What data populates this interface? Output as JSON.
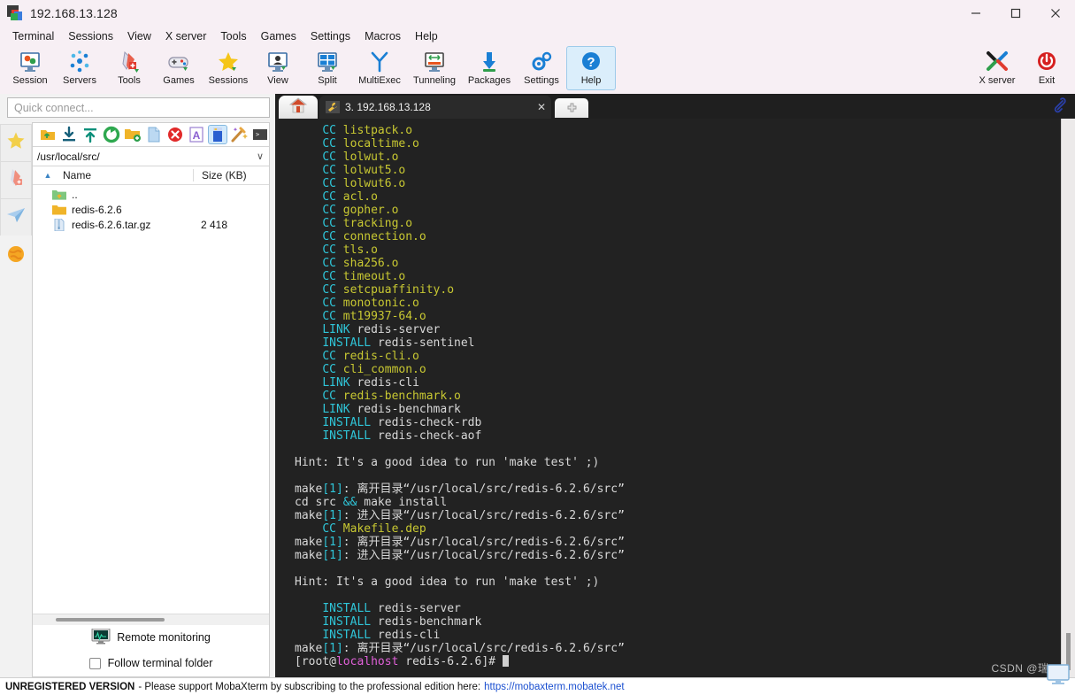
{
  "window": {
    "title": "192.168.13.128",
    "app_icon": "mobaxterm-logo-icon",
    "minimize": "—",
    "maximize": "□",
    "close": "✕"
  },
  "menubar": {
    "items": [
      {
        "label": "Terminal"
      },
      {
        "label": "Sessions"
      },
      {
        "label": "View"
      },
      {
        "label": "X server"
      },
      {
        "label": "Tools"
      },
      {
        "label": "Games"
      },
      {
        "label": "Settings"
      },
      {
        "label": "Macros"
      },
      {
        "label": "Help"
      }
    ]
  },
  "toolbar": {
    "buttons": [
      {
        "label": "Session",
        "icon": "session-icon",
        "selected": false
      },
      {
        "label": "Servers",
        "icon": "servers-icon",
        "selected": false
      },
      {
        "label": "Tools",
        "icon": "tools-icon",
        "selected": false
      },
      {
        "label": "Games",
        "icon": "games-icon",
        "selected": false
      },
      {
        "label": "Sessions",
        "icon": "sessions-star-icon",
        "selected": false
      },
      {
        "label": "View",
        "icon": "view-icon",
        "selected": false
      },
      {
        "label": "Split",
        "icon": "split-icon",
        "selected": false
      },
      {
        "label": "MultiExec",
        "icon": "multiexec-icon",
        "selected": false
      },
      {
        "label": "Tunneling",
        "icon": "tunneling-icon",
        "selected": false
      },
      {
        "label": "Packages",
        "icon": "packages-icon",
        "selected": false
      },
      {
        "label": "Settings",
        "icon": "settings-gear-icon",
        "selected": false
      },
      {
        "label": "Help",
        "icon": "help-icon",
        "selected": true
      }
    ],
    "right_buttons": [
      {
        "label": "X server",
        "icon": "x-server-icon"
      },
      {
        "label": "Exit",
        "icon": "exit-power-icon"
      }
    ]
  },
  "sidebar": {
    "quick_connect_placeholder": "Quick connect...",
    "rail_items": [
      {
        "icon": "star-bookmarks-icon"
      },
      {
        "icon": "tools-knife-icon"
      },
      {
        "icon": "paper-plane-sftp-icon"
      },
      {
        "icon": "globe-icon"
      }
    ],
    "sftp_toolbar": [
      {
        "icon": "go-up-folder-icon",
        "selected": false
      },
      {
        "icon": "download-icon",
        "selected": false
      },
      {
        "icon": "upload-icon",
        "selected": false
      },
      {
        "icon": "refresh-icon",
        "selected": false
      },
      {
        "icon": "new-folder-icon",
        "selected": false
      },
      {
        "icon": "new-file-icon",
        "selected": false
      },
      {
        "icon": "delete-icon",
        "selected": false
      },
      {
        "icon": "text-edit-icon",
        "selected": false
      },
      {
        "icon": "toggle-panel-icon",
        "selected": true
      },
      {
        "icon": "magic-wand-icon",
        "selected": false
      },
      {
        "icon": "open-terminal-icon",
        "selected": false
      }
    ],
    "path": "/usr/local/src/",
    "path_chevron": "∨",
    "columns": {
      "sort_arrow": "▲",
      "name": "Name",
      "size": "Size (KB)"
    },
    "files": [
      {
        "name": "..",
        "size": "",
        "icon": "parent-folder-icon"
      },
      {
        "name": "redis-6.2.6",
        "size": "",
        "icon": "folder-icon"
      },
      {
        "name": "redis-6.2.6.tar.gz",
        "size": "2 418",
        "icon": "archive-file-icon"
      }
    ],
    "remote_monitoring_label": "Remote monitoring",
    "follow_terminal_label": "Follow terminal folder",
    "follow_terminal_checked": false
  },
  "tabs": {
    "home_icon": "home-icon",
    "items": [
      {
        "label": "3. 192.168.13.128",
        "icon": "wrench-icon",
        "close": "✕",
        "active": true
      }
    ],
    "new_tab": "+",
    "clip_icon": "paperclip-icon"
  },
  "terminal": {
    "lines": [
      {
        "indent": 4,
        "segments": [
          {
            "t": "CC",
            "c": "cyan"
          },
          {
            "t": " listpack.o",
            "c": "yellow"
          }
        ]
      },
      {
        "indent": 4,
        "segments": [
          {
            "t": "CC",
            "c": "cyan"
          },
          {
            "t": " localtime.o",
            "c": "yellow"
          }
        ]
      },
      {
        "indent": 4,
        "segments": [
          {
            "t": "CC",
            "c": "cyan"
          },
          {
            "t": " lolwut.o",
            "c": "yellow"
          }
        ]
      },
      {
        "indent": 4,
        "segments": [
          {
            "t": "CC",
            "c": "cyan"
          },
          {
            "t": " lolwut5.o",
            "c": "yellow"
          }
        ]
      },
      {
        "indent": 4,
        "segments": [
          {
            "t": "CC",
            "c": "cyan"
          },
          {
            "t": " lolwut6.o",
            "c": "yellow"
          }
        ]
      },
      {
        "indent": 4,
        "segments": [
          {
            "t": "CC",
            "c": "cyan"
          },
          {
            "t": " acl.o",
            "c": "yellow"
          }
        ]
      },
      {
        "indent": 4,
        "segments": [
          {
            "t": "CC",
            "c": "cyan"
          },
          {
            "t": " gopher.o",
            "c": "yellow"
          }
        ]
      },
      {
        "indent": 4,
        "segments": [
          {
            "t": "CC",
            "c": "cyan"
          },
          {
            "t": " tracking.o",
            "c": "yellow"
          }
        ]
      },
      {
        "indent": 4,
        "segments": [
          {
            "t": "CC",
            "c": "cyan"
          },
          {
            "t": " connection.o",
            "c": "yellow"
          }
        ]
      },
      {
        "indent": 4,
        "segments": [
          {
            "t": "CC",
            "c": "cyan"
          },
          {
            "t": " tls.o",
            "c": "yellow"
          }
        ]
      },
      {
        "indent": 4,
        "segments": [
          {
            "t": "CC",
            "c": "cyan"
          },
          {
            "t": " sha256.o",
            "c": "yellow"
          }
        ]
      },
      {
        "indent": 4,
        "segments": [
          {
            "t": "CC",
            "c": "cyan"
          },
          {
            "t": " timeout.o",
            "c": "yellow"
          }
        ]
      },
      {
        "indent": 4,
        "segments": [
          {
            "t": "CC",
            "c": "cyan"
          },
          {
            "t": " setcpuaffinity.o",
            "c": "yellow"
          }
        ]
      },
      {
        "indent": 4,
        "segments": [
          {
            "t": "CC",
            "c": "cyan"
          },
          {
            "t": " monotonic.o",
            "c": "yellow"
          }
        ]
      },
      {
        "indent": 4,
        "segments": [
          {
            "t": "CC",
            "c": "cyan"
          },
          {
            "t": " mt19937-64.o",
            "c": "yellow"
          }
        ]
      },
      {
        "indent": 4,
        "segments": [
          {
            "t": "LINK",
            "c": "cyan"
          },
          {
            "t": " redis-server",
            "c": "white"
          }
        ]
      },
      {
        "indent": 4,
        "segments": [
          {
            "t": "INSTALL",
            "c": "cyan"
          },
          {
            "t": " redis-sentinel",
            "c": "white"
          }
        ]
      },
      {
        "indent": 4,
        "segments": [
          {
            "t": "CC",
            "c": "cyan"
          },
          {
            "t": " redis-cli.o",
            "c": "yellow"
          }
        ]
      },
      {
        "indent": 4,
        "segments": [
          {
            "t": "CC",
            "c": "cyan"
          },
          {
            "t": " cli_common.o",
            "c": "yellow"
          }
        ]
      },
      {
        "indent": 4,
        "segments": [
          {
            "t": "LINK",
            "c": "cyan"
          },
          {
            "t": " redis-cli",
            "c": "white"
          }
        ]
      },
      {
        "indent": 4,
        "segments": [
          {
            "t": "CC",
            "c": "cyan"
          },
          {
            "t": " redis-benchmark.o",
            "c": "yellow"
          }
        ]
      },
      {
        "indent": 4,
        "segments": [
          {
            "t": "LINK",
            "c": "cyan"
          },
          {
            "t": " redis-benchmark",
            "c": "white"
          }
        ]
      },
      {
        "indent": 4,
        "segments": [
          {
            "t": "INSTALL",
            "c": "cyan"
          },
          {
            "t": " redis-check-rdb",
            "c": "white"
          }
        ]
      },
      {
        "indent": 4,
        "segments": [
          {
            "t": "INSTALL",
            "c": "cyan"
          },
          {
            "t": " redis-check-aof",
            "c": "white"
          }
        ]
      },
      {
        "indent": 0,
        "segments": []
      },
      {
        "indent": 0,
        "segments": [
          {
            "t": "Hint: It's a good idea to run 'make test' ;)",
            "c": "white"
          }
        ]
      },
      {
        "indent": 0,
        "segments": []
      },
      {
        "indent": 0,
        "segments": [
          {
            "t": "make",
            "c": "white"
          },
          {
            "t": "[1]",
            "c": "cyan"
          },
          {
            "t": ": 离开目录“/usr/local/src/redis-6.2.6/src”",
            "c": "white"
          }
        ]
      },
      {
        "indent": 0,
        "segments": [
          {
            "t": "cd src ",
            "c": "white"
          },
          {
            "t": "&&",
            "c": "cyan"
          },
          {
            "t": " make install",
            "c": "white"
          }
        ]
      },
      {
        "indent": 0,
        "segments": [
          {
            "t": "make",
            "c": "white"
          },
          {
            "t": "[1]",
            "c": "cyan"
          },
          {
            "t": ": 进入目录“/usr/local/src/redis-6.2.6/src”",
            "c": "white"
          }
        ]
      },
      {
        "indent": 4,
        "segments": [
          {
            "t": "CC",
            "c": "cyan"
          },
          {
            "t": " Makefile.dep",
            "c": "yellow"
          }
        ]
      },
      {
        "indent": 0,
        "segments": [
          {
            "t": "make",
            "c": "white"
          },
          {
            "t": "[1]",
            "c": "cyan"
          },
          {
            "t": ": 离开目录“/usr/local/src/redis-6.2.6/src”",
            "c": "white"
          }
        ]
      },
      {
        "indent": 0,
        "segments": [
          {
            "t": "make",
            "c": "white"
          },
          {
            "t": "[1]",
            "c": "cyan"
          },
          {
            "t": ": 进入目录“/usr/local/src/redis-6.2.6/src”",
            "c": "white"
          }
        ]
      },
      {
        "indent": 0,
        "segments": []
      },
      {
        "indent": 0,
        "segments": [
          {
            "t": "Hint: It's a good idea to run 'make test' ;)",
            "c": "white"
          }
        ]
      },
      {
        "indent": 0,
        "segments": []
      },
      {
        "indent": 4,
        "segments": [
          {
            "t": "INSTALL",
            "c": "cyan"
          },
          {
            "t": " redis-server",
            "c": "white"
          }
        ]
      },
      {
        "indent": 4,
        "segments": [
          {
            "t": "INSTALL",
            "c": "cyan"
          },
          {
            "t": " redis-benchmark",
            "c": "white"
          }
        ]
      },
      {
        "indent": 4,
        "segments": [
          {
            "t": "INSTALL",
            "c": "cyan"
          },
          {
            "t": " redis-cli",
            "c": "white"
          }
        ]
      },
      {
        "indent": 0,
        "segments": [
          {
            "t": "make",
            "c": "white"
          },
          {
            "t": "[1]",
            "c": "cyan"
          },
          {
            "t": ": 离开目录“/usr/local/src/redis-6.2.6/src”",
            "c": "white"
          }
        ]
      },
      {
        "indent": 0,
        "segments": [
          {
            "t": "[root@",
            "c": "white"
          },
          {
            "t": "localhost",
            "c": "magenta"
          },
          {
            "t": " redis-6.2.6]# ",
            "c": "white"
          },
          {
            "t": "",
            "c": "cursor"
          }
        ]
      }
    ]
  },
  "statusbar": {
    "unregistered": "UNREGISTERED VERSION",
    "message": "-  Please support MobaXterm by subscribing to the professional edition here:",
    "link": "https://mobaxterm.mobatek.net"
  },
  "watermark": {
    "text": "CSDN @瑞486"
  }
}
